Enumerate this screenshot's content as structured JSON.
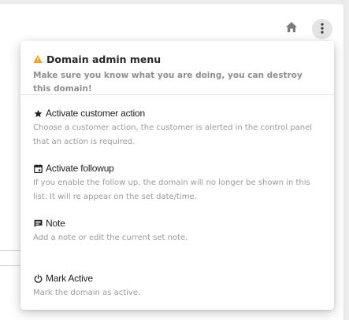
{
  "toolbar": {
    "home_icon": "home-icon",
    "more_icon": "more-vertical-icon"
  },
  "menu": {
    "header": {
      "icon": "warning-icon",
      "icon_color": "#f0a020",
      "title": "Domain admin menu",
      "warning": "Make sure you know what you are doing, you can destroy this domain!"
    },
    "items": [
      {
        "icon": "star-icon",
        "label": "Activate customer action",
        "description": "Choose a customer action, the customer is alerted in the control panel that an action is required."
      },
      {
        "icon": "calendar-icon",
        "label": "Activate followup",
        "description": "If you enable the follow up, the domain will no longer be shown in this list. It will re appear on the set date/time."
      },
      {
        "icon": "note-icon",
        "label": "Note",
        "description": "Add a note or edit the current set note."
      },
      {
        "icon": "power-icon",
        "label": "Mark Active",
        "description": "Mark the domain as active."
      }
    ]
  },
  "colors": {
    "accent_warning": "#f0a020",
    "text_primary": "#222222",
    "text_muted": "#9a9a9a"
  }
}
